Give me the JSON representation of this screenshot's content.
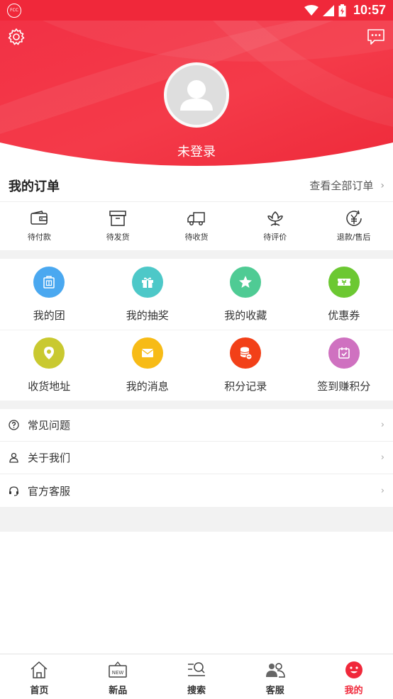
{
  "status_bar": {
    "time": "10:57",
    "app_icon_text": "FCC"
  },
  "header": {
    "login_status": "未登录"
  },
  "orders": {
    "title": "我的订单",
    "view_all": "查看全部订单",
    "items": [
      {
        "label": "待付款",
        "icon": "wallet-icon"
      },
      {
        "label": "待发货",
        "icon": "box-icon"
      },
      {
        "label": "待收货",
        "icon": "truck-icon"
      },
      {
        "label": "待评价",
        "icon": "flower-icon"
      },
      {
        "label": "退款/售后",
        "icon": "refund-icon"
      }
    ]
  },
  "features": [
    {
      "label": "我的团",
      "icon": "group-bag-icon",
      "color": "#4aa8f0"
    },
    {
      "label": "我的抽奖",
      "icon": "gift-icon",
      "color": "#4dc8c8"
    },
    {
      "label": "我的收藏",
      "icon": "star-icon",
      "color": "#4fcb94"
    },
    {
      "label": "优惠券",
      "icon": "coupon-icon",
      "color": "#6cc832"
    },
    {
      "label": "收货地址",
      "icon": "location-icon",
      "color": "#c9c930"
    },
    {
      "label": "我的消息",
      "icon": "mail-icon",
      "color": "#f7bb16"
    },
    {
      "label": "积分记录",
      "icon": "coins-icon",
      "color": "#f24018"
    },
    {
      "label": "签到赚积分",
      "icon": "calendar-check-icon",
      "color": "#cf71c0"
    }
  ],
  "menu": [
    {
      "label": "常见问题",
      "icon": "question-icon"
    },
    {
      "label": "关于我们",
      "icon": "person-icon"
    },
    {
      "label": "官方客服",
      "icon": "headset-icon"
    }
  ],
  "nav": [
    {
      "label": "首页",
      "icon": "home-icon",
      "active": false
    },
    {
      "label": "新品",
      "icon": "new-sign-icon",
      "active": false
    },
    {
      "label": "搜索",
      "icon": "search-icon",
      "active": false
    },
    {
      "label": "客服",
      "icon": "users-icon",
      "active": false
    },
    {
      "label": "我的",
      "icon": "profile-smile-icon",
      "active": true
    }
  ],
  "colors": {
    "brand_red": "#f0283a",
    "accent_red": "#f0283a"
  }
}
